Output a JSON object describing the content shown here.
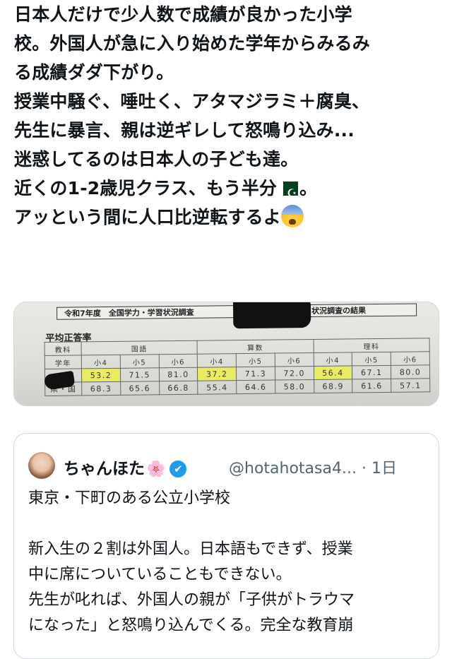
{
  "post": {
    "lines": [
      "日本人だけで少人数で成績が良かった小学",
      "校。外国人が急に入り始めた学年からみるみ",
      "る成績ダダ下がり。",
      "授業中騒ぐ、唾吐く、アタマジラミ＋腐臭、",
      "先生に暴言、親は逆ギレして怒鳴り込み...",
      "迷惑してるのは日本人の子ども達。",
      "近くの1-2歳児クラス、もう半分",
      "。",
      "アッという間に人口比逆転するよ"
    ],
    "flag_icon": "pakistan-flag-emoji",
    "face_icon": "anxious-face-emoji"
  },
  "photo": {
    "title_left": "令和7年度　全国学力・学習状況調査",
    "title_right": "状況調査の結果",
    "subtitle": "平均正答率",
    "table": {
      "row_label_subject": "教科",
      "row_label_grade": "学年",
      "row_label_pref": "県・国",
      "subjects": [
        "国語",
        "算数",
        "理科"
      ],
      "grades": [
        "小4",
        "小5",
        "小6",
        "小4",
        "小5",
        "小6",
        "小4",
        "小5",
        "小6"
      ],
      "school_values": [
        "53.2",
        "71.5",
        "81.0",
        "37.2",
        "71.3",
        "72.0",
        "56.4",
        "67.1",
        "80.0"
      ],
      "pref_values": [
        "68.3",
        "65.6",
        "66.8",
        "55.4",
        "64.6",
        "58.0",
        "68.9",
        "61.6",
        "57.1"
      ],
      "highlight_color": "#e9ec63"
    }
  },
  "quote": {
    "name": "ちゃんほた",
    "name_emoji": "🌸",
    "verified_mark": "✔",
    "handle": "@hotahotasa4...",
    "separator": "·",
    "time": "1日",
    "lines": [
      "東京・下町のある公立小学校",
      "",
      "新入生の２割は外国人。日本語もできず、授業",
      "中に席についていることもできない。",
      "先生が叱れば、外国人の親が「子供がトラウマ",
      "になった」と怒鳴り込んでくる。完全な教育崩"
    ],
    "verified_color": "#1d9bf0"
  }
}
